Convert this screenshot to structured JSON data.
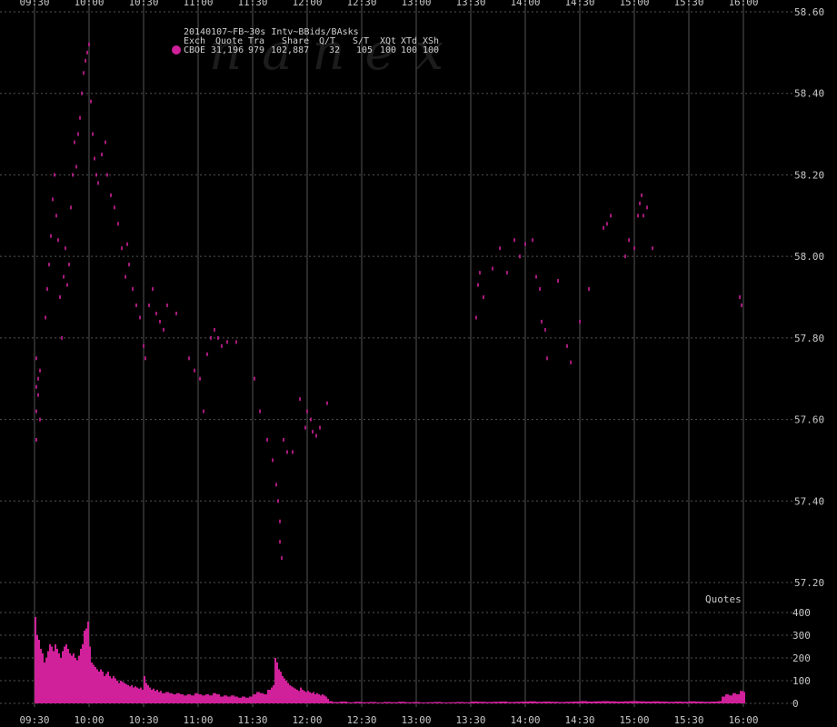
{
  "chart_data": {
    "type": "scatter",
    "title": "20140107~FB~30s Intv~BBids/BAsks",
    "watermark": "nanex",
    "x_ticks": [
      "09:30",
      "10:00",
      "10:30",
      "11:00",
      "11:30",
      "12:00",
      "12:30",
      "13:00",
      "13:30",
      "14:00",
      "14:30",
      "15:00",
      "15:30",
      "16:00"
    ],
    "price_ticks": [
      "58.60",
      "58.40",
      "58.20",
      "58.00",
      "57.80",
      "57.60",
      "57.40",
      "57.20"
    ],
    "price_ylim": [
      57.2,
      58.6
    ],
    "volume_label": "Quotes",
    "volume_ticks": [
      "400",
      "300",
      "200",
      "100",
      "0"
    ],
    "volume_ylim": [
      0,
      400
    ],
    "legend": {
      "headers": [
        "Exch",
        "Quote",
        "Tra",
        "Share",
        "Q/T",
        "S/T",
        "XQt",
        "XTd",
        "XSh"
      ],
      "row": [
        "CBOE",
        "31,196",
        "979",
        "102,887",
        "32",
        "105",
        "100",
        "100",
        "100"
      ]
    },
    "colors": {
      "series": "#d0209a",
      "grid": "#555555",
      "background": "#000000"
    },
    "series": [
      {
        "name": "CBOE",
        "points": [
          [
            "09:31",
            57.55
          ],
          [
            "09:31",
            57.62
          ],
          [
            "09:31",
            57.68
          ],
          [
            "09:31",
            57.75
          ],
          [
            "09:32",
            57.66
          ],
          [
            "09:32",
            57.7
          ],
          [
            "09:33",
            57.6
          ],
          [
            "09:33",
            57.72
          ],
          [
            "09:36",
            57.85
          ],
          [
            "09:37",
            57.92
          ],
          [
            "09:38",
            57.98
          ],
          [
            "09:39",
            58.05
          ],
          [
            "09:40",
            58.14
          ],
          [
            "09:41",
            58.2
          ],
          [
            "09:42",
            58.1
          ],
          [
            "09:43",
            58.04
          ],
          [
            "09:44",
            57.9
          ],
          [
            "09:45",
            57.8
          ],
          [
            "09:46",
            57.95
          ],
          [
            "09:47",
            58.02
          ],
          [
            "09:48",
            57.93
          ],
          [
            "09:49",
            57.98
          ],
          [
            "09:50",
            58.12
          ],
          [
            "09:51",
            58.2
          ],
          [
            "09:52",
            58.28
          ],
          [
            "09:53",
            58.22
          ],
          [
            "09:54",
            58.3
          ],
          [
            "09:55",
            58.34
          ],
          [
            "09:56",
            58.4
          ],
          [
            "09:57",
            58.45
          ],
          [
            "09:58",
            58.48
          ],
          [
            "09:59",
            58.5
          ],
          [
            "10:00",
            58.52
          ],
          [
            "10:01",
            58.38
          ],
          [
            "10:02",
            58.3
          ],
          [
            "10:03",
            58.24
          ],
          [
            "10:04",
            58.2
          ],
          [
            "10:05",
            58.18
          ],
          [
            "10:07",
            58.25
          ],
          [
            "10:09",
            58.28
          ],
          [
            "10:10",
            58.2
          ],
          [
            "10:12",
            58.15
          ],
          [
            "10:14",
            58.12
          ],
          [
            "10:16",
            58.08
          ],
          [
            "10:18",
            58.02
          ],
          [
            "10:20",
            57.95
          ],
          [
            "10:21",
            58.03
          ],
          [
            "10:22",
            57.98
          ],
          [
            "10:24",
            57.92
          ],
          [
            "10:26",
            57.88
          ],
          [
            "10:28",
            57.85
          ],
          [
            "10:30",
            57.78
          ],
          [
            "10:31",
            57.75
          ],
          [
            "10:33",
            57.88
          ],
          [
            "10:35",
            57.92
          ],
          [
            "10:37",
            57.86
          ],
          [
            "10:39",
            57.84
          ],
          [
            "10:41",
            57.82
          ],
          [
            "10:43",
            57.88
          ],
          [
            "10:48",
            57.86
          ],
          [
            "10:55",
            57.75
          ],
          [
            "10:58",
            57.72
          ],
          [
            "11:01",
            57.7
          ],
          [
            "11:03",
            57.62
          ],
          [
            "11:05",
            57.76
          ],
          [
            "11:07",
            57.8
          ],
          [
            "11:09",
            57.82
          ],
          [
            "11:11",
            57.8
          ],
          [
            "11:13",
            57.78
          ],
          [
            "11:16",
            57.79
          ],
          [
            "11:21",
            57.79
          ],
          [
            "11:31",
            57.7
          ],
          [
            "11:34",
            57.62
          ],
          [
            "11:38",
            57.55
          ],
          [
            "11:41",
            57.5
          ],
          [
            "11:43",
            57.44
          ],
          [
            "11:44",
            57.4
          ],
          [
            "11:45",
            57.35
          ],
          [
            "11:45",
            57.3
          ],
          [
            "11:46",
            57.26
          ],
          [
            "11:47",
            57.55
          ],
          [
            "11:49",
            57.52
          ],
          [
            "11:52",
            57.52
          ],
          [
            "11:56",
            57.65
          ],
          [
            "11:59",
            57.58
          ],
          [
            "12:00",
            57.62
          ],
          [
            "12:02",
            57.6
          ],
          [
            "12:03",
            57.57
          ],
          [
            "12:05",
            57.56
          ],
          [
            "12:07",
            57.58
          ],
          [
            "12:11",
            57.64
          ],
          [
            "13:33",
            57.85
          ],
          [
            "13:34",
            57.93
          ],
          [
            "13:35",
            57.96
          ],
          [
            "13:37",
            57.9
          ],
          [
            "13:42",
            57.97
          ],
          [
            "13:46",
            58.02
          ],
          [
            "13:50",
            57.96
          ],
          [
            "13:54",
            58.04
          ],
          [
            "13:57",
            58.0
          ],
          [
            "14:00",
            58.03
          ],
          [
            "14:04",
            58.04
          ],
          [
            "14:06",
            57.95
          ],
          [
            "14:08",
            57.92
          ],
          [
            "14:09",
            57.84
          ],
          [
            "14:11",
            57.82
          ],
          [
            "14:12",
            57.75
          ],
          [
            "14:18",
            57.94
          ],
          [
            "14:23",
            57.78
          ],
          [
            "14:25",
            57.74
          ],
          [
            "14:30",
            57.84
          ],
          [
            "14:35",
            57.92
          ],
          [
            "14:43",
            58.07
          ],
          [
            "14:45",
            58.08
          ],
          [
            "14:47",
            58.1
          ],
          [
            "14:55",
            58.0
          ],
          [
            "14:57",
            58.04
          ],
          [
            "15:00",
            58.02
          ],
          [
            "15:02",
            58.1
          ],
          [
            "15:03",
            58.13
          ],
          [
            "15:04",
            58.15
          ],
          [
            "15:05",
            58.1
          ],
          [
            "15:07",
            58.12
          ],
          [
            "15:10",
            58.02
          ],
          [
            "15:58",
            57.9
          ],
          [
            "15:59",
            57.88
          ]
        ]
      }
    ],
    "volume_series": {
      "name": "Quotes",
      "points": [
        [
          "09:30",
          380
        ],
        [
          "09:31",
          300
        ],
        [
          "09:32",
          280
        ],
        [
          "09:33",
          240
        ],
        [
          "09:34",
          220
        ],
        [
          "09:35",
          180
        ],
        [
          "09:36",
          200
        ],
        [
          "09:37",
          230
        ],
        [
          "09:38",
          260
        ],
        [
          "09:39",
          250
        ],
        [
          "09:40",
          230
        ],
        [
          "09:41",
          260
        ],
        [
          "09:42",
          240
        ],
        [
          "09:43",
          220
        ],
        [
          "09:44",
          200
        ],
        [
          "09:45",
          230
        ],
        [
          "09:46",
          250
        ],
        [
          "09:47",
          260
        ],
        [
          "09:48",
          240
        ],
        [
          "09:49",
          220
        ],
        [
          "09:50",
          210
        ],
        [
          "09:51",
          220
        ],
        [
          "09:52",
          200
        ],
        [
          "09:53",
          190
        ],
        [
          "09:54",
          210
        ],
        [
          "09:55",
          240
        ],
        [
          "09:56",
          260
        ],
        [
          "09:57",
          320
        ],
        [
          "09:58",
          330
        ],
        [
          "09:59",
          360
        ],
        [
          "10:00",
          250
        ],
        [
          "10:01",
          180
        ],
        [
          "10:02",
          170
        ],
        [
          "10:03",
          160
        ],
        [
          "10:04",
          150
        ],
        [
          "10:05",
          140
        ],
        [
          "10:06",
          150
        ],
        [
          "10:07",
          140
        ],
        [
          "10:08",
          120
        ],
        [
          "10:09",
          130
        ],
        [
          "10:10",
          140
        ],
        [
          "10:11",
          120
        ],
        [
          "10:12",
          110
        ],
        [
          "10:13",
          120
        ],
        [
          "10:14",
          110
        ],
        [
          "10:15",
          100
        ],
        [
          "10:16",
          90
        ],
        [
          "10:17",
          100
        ],
        [
          "10:18",
          95
        ],
        [
          "10:19",
          90
        ],
        [
          "10:20",
          85
        ],
        [
          "10:21",
          80
        ],
        [
          "10:22",
          75
        ],
        [
          "10:23",
          80
        ],
        [
          "10:24",
          70
        ],
        [
          "10:25",
          75
        ],
        [
          "10:26",
          70
        ],
        [
          "10:27",
          65
        ],
        [
          "10:28",
          70
        ],
        [
          "10:29",
          60
        ],
        [
          "10:30",
          120
        ],
        [
          "10:31",
          90
        ],
        [
          "10:32",
          80
        ],
        [
          "10:33",
          70
        ],
        [
          "10:34",
          60
        ],
        [
          "10:35",
          65
        ],
        [
          "10:36",
          55
        ],
        [
          "10:37",
          60
        ],
        [
          "10:38",
          50
        ],
        [
          "10:39",
          55
        ],
        [
          "10:40",
          45
        ],
        [
          "10:42",
          50
        ],
        [
          "10:44",
          45
        ],
        [
          "10:46",
          40
        ],
        [
          "10:48",
          45
        ],
        [
          "10:50",
          40
        ],
        [
          "10:52",
          35
        ],
        [
          "10:54",
          40
        ],
        [
          "10:56",
          35
        ],
        [
          "10:58",
          45
        ],
        [
          "11:00",
          40
        ],
        [
          "11:02",
          35
        ],
        [
          "11:04",
          40
        ],
        [
          "11:06",
          35
        ],
        [
          "11:08",
          45
        ],
        [
          "11:10",
          40
        ],
        [
          "11:12",
          30
        ],
        [
          "11:14",
          35
        ],
        [
          "11:16",
          30
        ],
        [
          "11:18",
          35
        ],
        [
          "11:20",
          30
        ],
        [
          "11:22",
          25
        ],
        [
          "11:24",
          30
        ],
        [
          "11:26",
          25
        ],
        [
          "11:28",
          30
        ],
        [
          "11:30",
          40
        ],
        [
          "11:32",
          50
        ],
        [
          "11:34",
          45
        ],
        [
          "11:36",
          40
        ],
        [
          "11:38",
          60
        ],
        [
          "11:40",
          70
        ],
        [
          "11:41",
          80
        ],
        [
          "11:42",
          200
        ],
        [
          "11:43",
          180
        ],
        [
          "11:44",
          150
        ],
        [
          "11:45",
          140
        ],
        [
          "11:46",
          120
        ],
        [
          "11:47",
          110
        ],
        [
          "11:48",
          100
        ],
        [
          "11:49",
          90
        ],
        [
          "11:50",
          80
        ],
        [
          "11:51",
          75
        ],
        [
          "11:52",
          70
        ],
        [
          "11:53",
          65
        ],
        [
          "11:54",
          60
        ],
        [
          "11:55",
          55
        ],
        [
          "11:56",
          70
        ],
        [
          "11:57",
          60
        ],
        [
          "11:58",
          55
        ],
        [
          "11:59",
          50
        ],
        [
          "12:00",
          55
        ],
        [
          "12:01",
          50
        ],
        [
          "12:02",
          45
        ],
        [
          "12:03",
          50
        ],
        [
          "12:04",
          40
        ],
        [
          "12:05",
          45
        ],
        [
          "12:06",
          40
        ],
        [
          "12:07",
          35
        ],
        [
          "12:08",
          40
        ],
        [
          "12:09",
          35
        ],
        [
          "12:10",
          30
        ],
        [
          "12:11",
          20
        ],
        [
          "12:12",
          10
        ],
        [
          "12:14",
          6
        ],
        [
          "12:18",
          8
        ],
        [
          "12:22",
          5
        ],
        [
          "12:26",
          7
        ],
        [
          "12:30",
          5
        ],
        [
          "12:34",
          6
        ],
        [
          "12:38",
          4
        ],
        [
          "12:42",
          6
        ],
        [
          "12:46",
          5
        ],
        [
          "12:50",
          7
        ],
        [
          "12:54",
          5
        ],
        [
          "12:58",
          6
        ],
        [
          "13:02",
          4
        ],
        [
          "13:06",
          5
        ],
        [
          "13:10",
          6
        ],
        [
          "13:14",
          4
        ],
        [
          "13:18",
          5
        ],
        [
          "13:22",
          6
        ],
        [
          "13:26",
          5
        ],
        [
          "13:30",
          8
        ],
        [
          "13:34",
          7
        ],
        [
          "13:38",
          6
        ],
        [
          "13:42",
          7
        ],
        [
          "13:46",
          8
        ],
        [
          "13:50",
          6
        ],
        [
          "13:54",
          7
        ],
        [
          "13:58",
          8
        ],
        [
          "14:02",
          9
        ],
        [
          "14:06",
          7
        ],
        [
          "14:10",
          8
        ],
        [
          "14:14",
          7
        ],
        [
          "14:18",
          6
        ],
        [
          "14:22",
          7
        ],
        [
          "14:26",
          8
        ],
        [
          "14:30",
          10
        ],
        [
          "14:34",
          8
        ],
        [
          "14:38",
          9
        ],
        [
          "14:42",
          10
        ],
        [
          "14:46",
          9
        ],
        [
          "14:50",
          8
        ],
        [
          "14:54",
          9
        ],
        [
          "14:58",
          10
        ],
        [
          "15:02",
          9
        ],
        [
          "15:06",
          8
        ],
        [
          "15:10",
          9
        ],
        [
          "15:14",
          8
        ],
        [
          "15:18",
          7
        ],
        [
          "15:22",
          8
        ],
        [
          "15:26",
          7
        ],
        [
          "15:30",
          9
        ],
        [
          "15:34",
          8
        ],
        [
          "15:38",
          7
        ],
        [
          "15:42",
          8
        ],
        [
          "15:46",
          10
        ],
        [
          "15:48",
          30
        ],
        [
          "15:50",
          40
        ],
        [
          "15:52",
          35
        ],
        [
          "15:54",
          45
        ],
        [
          "15:56",
          40
        ],
        [
          "15:58",
          55
        ],
        [
          "16:00",
          50
        ]
      ]
    }
  }
}
